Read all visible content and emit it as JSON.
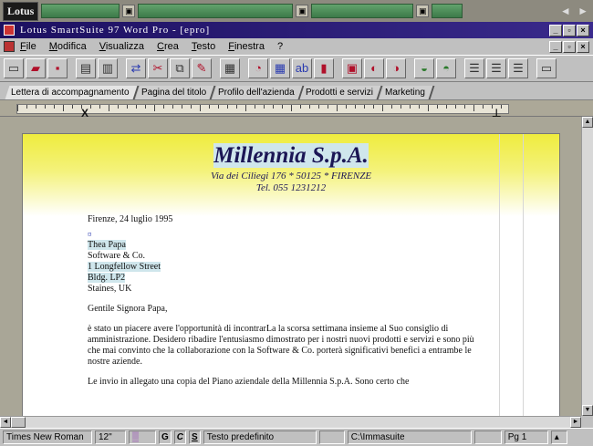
{
  "suite_bar": {
    "logo": "Lotus",
    "cells": [
      "",
      "",
      "",
      ""
    ],
    "nav": "◄ ►"
  },
  "title_bar": {
    "title": "Lotus SmartSuite 97     Word Pro - [epro]",
    "buttons": [
      "_",
      "▫",
      "×"
    ]
  },
  "menu": {
    "items": [
      "File",
      "Modifica",
      "Visualizza",
      "Crea",
      "Testo",
      "Finestra",
      "?"
    ],
    "doc_buttons": [
      "_",
      "▫",
      "×"
    ]
  },
  "tabs": [
    "Lettera di accompagnamento",
    "Pagina del titolo",
    "Profilo dell'azienda",
    "Prodotti e servizi",
    "Marketing"
  ],
  "document": {
    "company": "Millennia S.p.A.",
    "address": "Via dei Ciliegi 176 * 50125 * FIRENZE",
    "phone": "Tel. 055 1231212",
    "date": "Firenze, 24 luglio 1995",
    "recipient": [
      "Thea Papa",
      "Software & Co.",
      "1 Longfellow Street",
      "Bldg. LP2",
      "Staines, UK"
    ],
    "salutation": "Gentile Signora Papa,",
    "paragraph1": "è stato un piacere avere l'opportunità di incontrarLa la scorsa settimana insieme al Suo consiglio di amministrazione. Desidero ribadire l'entusiasmo dimostrato per i nostri nuovi prodotti e servizi e sono più che mai convinto che la collaborazione con la Software & Co. porterà significativi benefici a entrambe le nostre aziende.",
    "paragraph2": "Le invio in allegato una copia del Piano aziendale della Millennia S.p.A. Sono certo che"
  },
  "status_bar": {
    "font": "Times New Roman",
    "size": "12\"",
    "style_b": "G",
    "style_i": "C",
    "style_u": "S",
    "paragraph_style": "Testo predefinito",
    "path": "C:\\Immasuite",
    "page": "Pg 1"
  }
}
